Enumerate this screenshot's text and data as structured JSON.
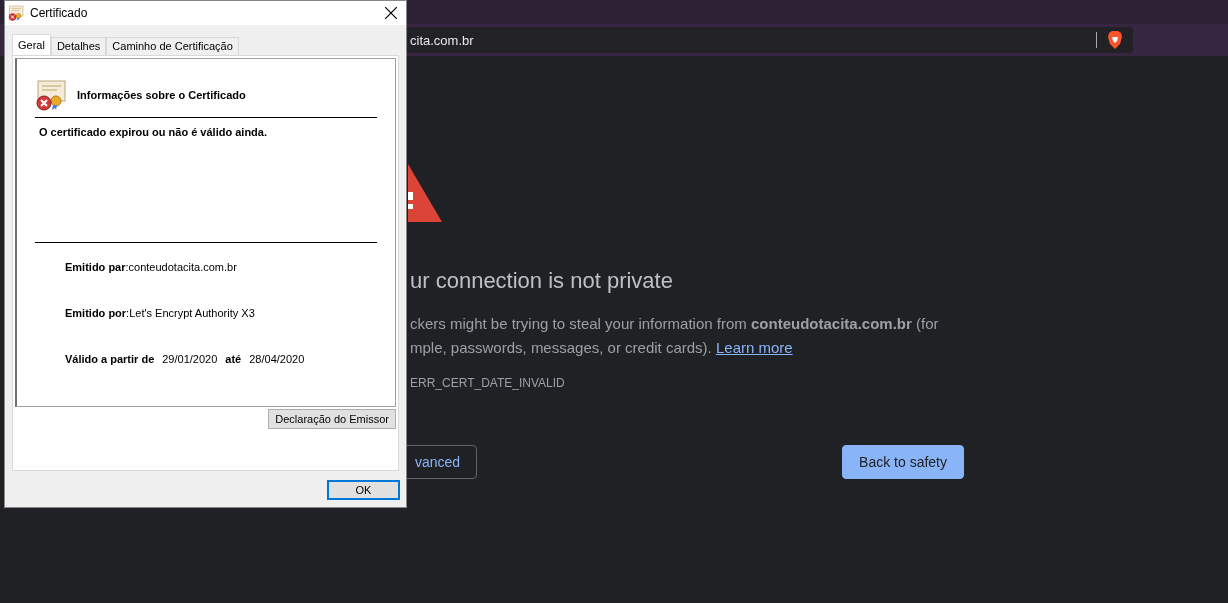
{
  "browser": {
    "address": "cita.com.br",
    "page": {
      "heading": "ur connection is not private",
      "message_lines": [
        "ckers might be trying to steal your information from **conteudotacita.com.br** (for",
        "mple, passwords, messages, or credit cards). "
      ],
      "learn_more": "Learn more",
      "error_code": "ERR_CERT_DATE_INVALID",
      "buttons": [
        {
          "kind": "secondary",
          "label": "vanced"
        },
        {
          "kind": "primary",
          "label": "Back to safety"
        }
      ]
    }
  },
  "dialog": {
    "title": "Certificado",
    "tabs": [
      {
        "label": "Geral",
        "selected": true
      },
      {
        "label": "Detalhes",
        "selected": false
      },
      {
        "label": "Caminho de Certificação",
        "selected": false
      }
    ],
    "info_title": "Informações sobre o Certificado",
    "status": "O certificado expirou ou não é válido ainda.",
    "fields": [
      {
        "label": "Emitido par",
        "value": ":conteudotacita.com.br"
      },
      {
        "label": "Emitido por",
        "value": ":Let's Encrypt Authority X3"
      }
    ],
    "validity": {
      "from_label": "Válido a partir de",
      "from": "29/01/2020",
      "to_label": "até",
      "to": "28/04/2020"
    },
    "issuer_button": "Declaração do Emissor",
    "ok_button": "OK"
  }
}
